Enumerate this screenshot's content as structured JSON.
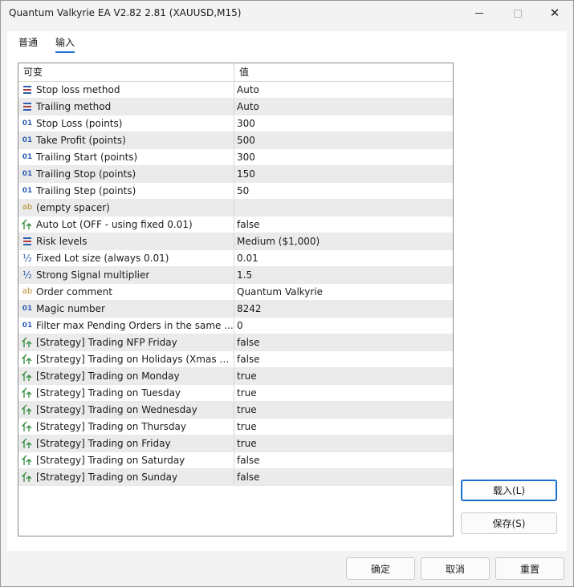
{
  "window": {
    "title": "Quantum Valkyrie EA V2.82 2.81 (XAUUSD,M15)",
    "minimize_symbol": "—",
    "maximize_symbol": "□",
    "close_symbol": "✕"
  },
  "tabs": [
    {
      "label": "普通",
      "active": false
    },
    {
      "label": "输入",
      "active": true
    }
  ],
  "grid": {
    "header_variable": "可变",
    "header_value": "值",
    "rows": [
      {
        "icon": "list-icon",
        "name": "Stop loss method",
        "value": "Auto"
      },
      {
        "icon": "list-icon",
        "name": "Trailing method",
        "value": "Auto"
      },
      {
        "icon": "integer-icon",
        "name": "Stop Loss (points)",
        "value": "300"
      },
      {
        "icon": "integer-icon",
        "name": "Take Profit (points)",
        "value": "500"
      },
      {
        "icon": "integer-icon",
        "name": "Trailing Start (points)",
        "value": "300"
      },
      {
        "icon": "integer-icon",
        "name": "Trailing Stop (points)",
        "value": "150"
      },
      {
        "icon": "integer-icon",
        "name": "Trailing Step (points)",
        "value": "50"
      },
      {
        "icon": "string-icon",
        "name": "(empty spacer)",
        "value": ""
      },
      {
        "icon": "bool-icon",
        "name": "Auto Lot (OFF - using fixed 0.01)",
        "value": "false"
      },
      {
        "icon": "list-icon",
        "name": "Risk levels",
        "value": "Medium ($1,000)"
      },
      {
        "icon": "double-icon",
        "name": "Fixed Lot size (always 0.01)",
        "value": "0.01"
      },
      {
        "icon": "double-icon",
        "name": "Strong Signal multiplier",
        "value": "1.5"
      },
      {
        "icon": "string-icon",
        "name": "Order comment",
        "value": "Quantum Valkyrie"
      },
      {
        "icon": "integer-icon",
        "name": "Magic number",
        "value": "8242"
      },
      {
        "icon": "integer-icon",
        "name": "Filter max Pending Orders in the same ...",
        "value": "0"
      },
      {
        "icon": "bool-icon",
        "name": "[Strategy] Trading NFP Friday",
        "value": "false"
      },
      {
        "icon": "bool-icon",
        "name": "[Strategy] Trading on Holidays (Xmas &...",
        "value": "false"
      },
      {
        "icon": "bool-icon",
        "name": "[Strategy] Trading on Monday",
        "value": "true"
      },
      {
        "icon": "bool-icon",
        "name": "[Strategy] Trading on Tuesday",
        "value": "true"
      },
      {
        "icon": "bool-icon",
        "name": "[Strategy] Trading on Wednesday",
        "value": "true"
      },
      {
        "icon": "bool-icon",
        "name": "[Strategy] Trading on Thursday",
        "value": "true"
      },
      {
        "icon": "bool-icon",
        "name": "[Strategy] Trading on Friday",
        "value": "true"
      },
      {
        "icon": "bool-icon",
        "name": "[Strategy] Trading on Saturday",
        "value": "false"
      },
      {
        "icon": "bool-icon",
        "name": "[Strategy] Trading on Sunday",
        "value": "false"
      }
    ]
  },
  "buttons": {
    "load": "载入(L)",
    "save": "保存(S)",
    "ok": "确定",
    "cancel": "取消",
    "reset": "重置"
  },
  "colors": {
    "accent": "#1f6fd0",
    "alt_row": "#ebebeb",
    "bool_icon": "#2e8b3a",
    "number_icon": "#2d5fb0",
    "string_icon": "#b9892a"
  }
}
